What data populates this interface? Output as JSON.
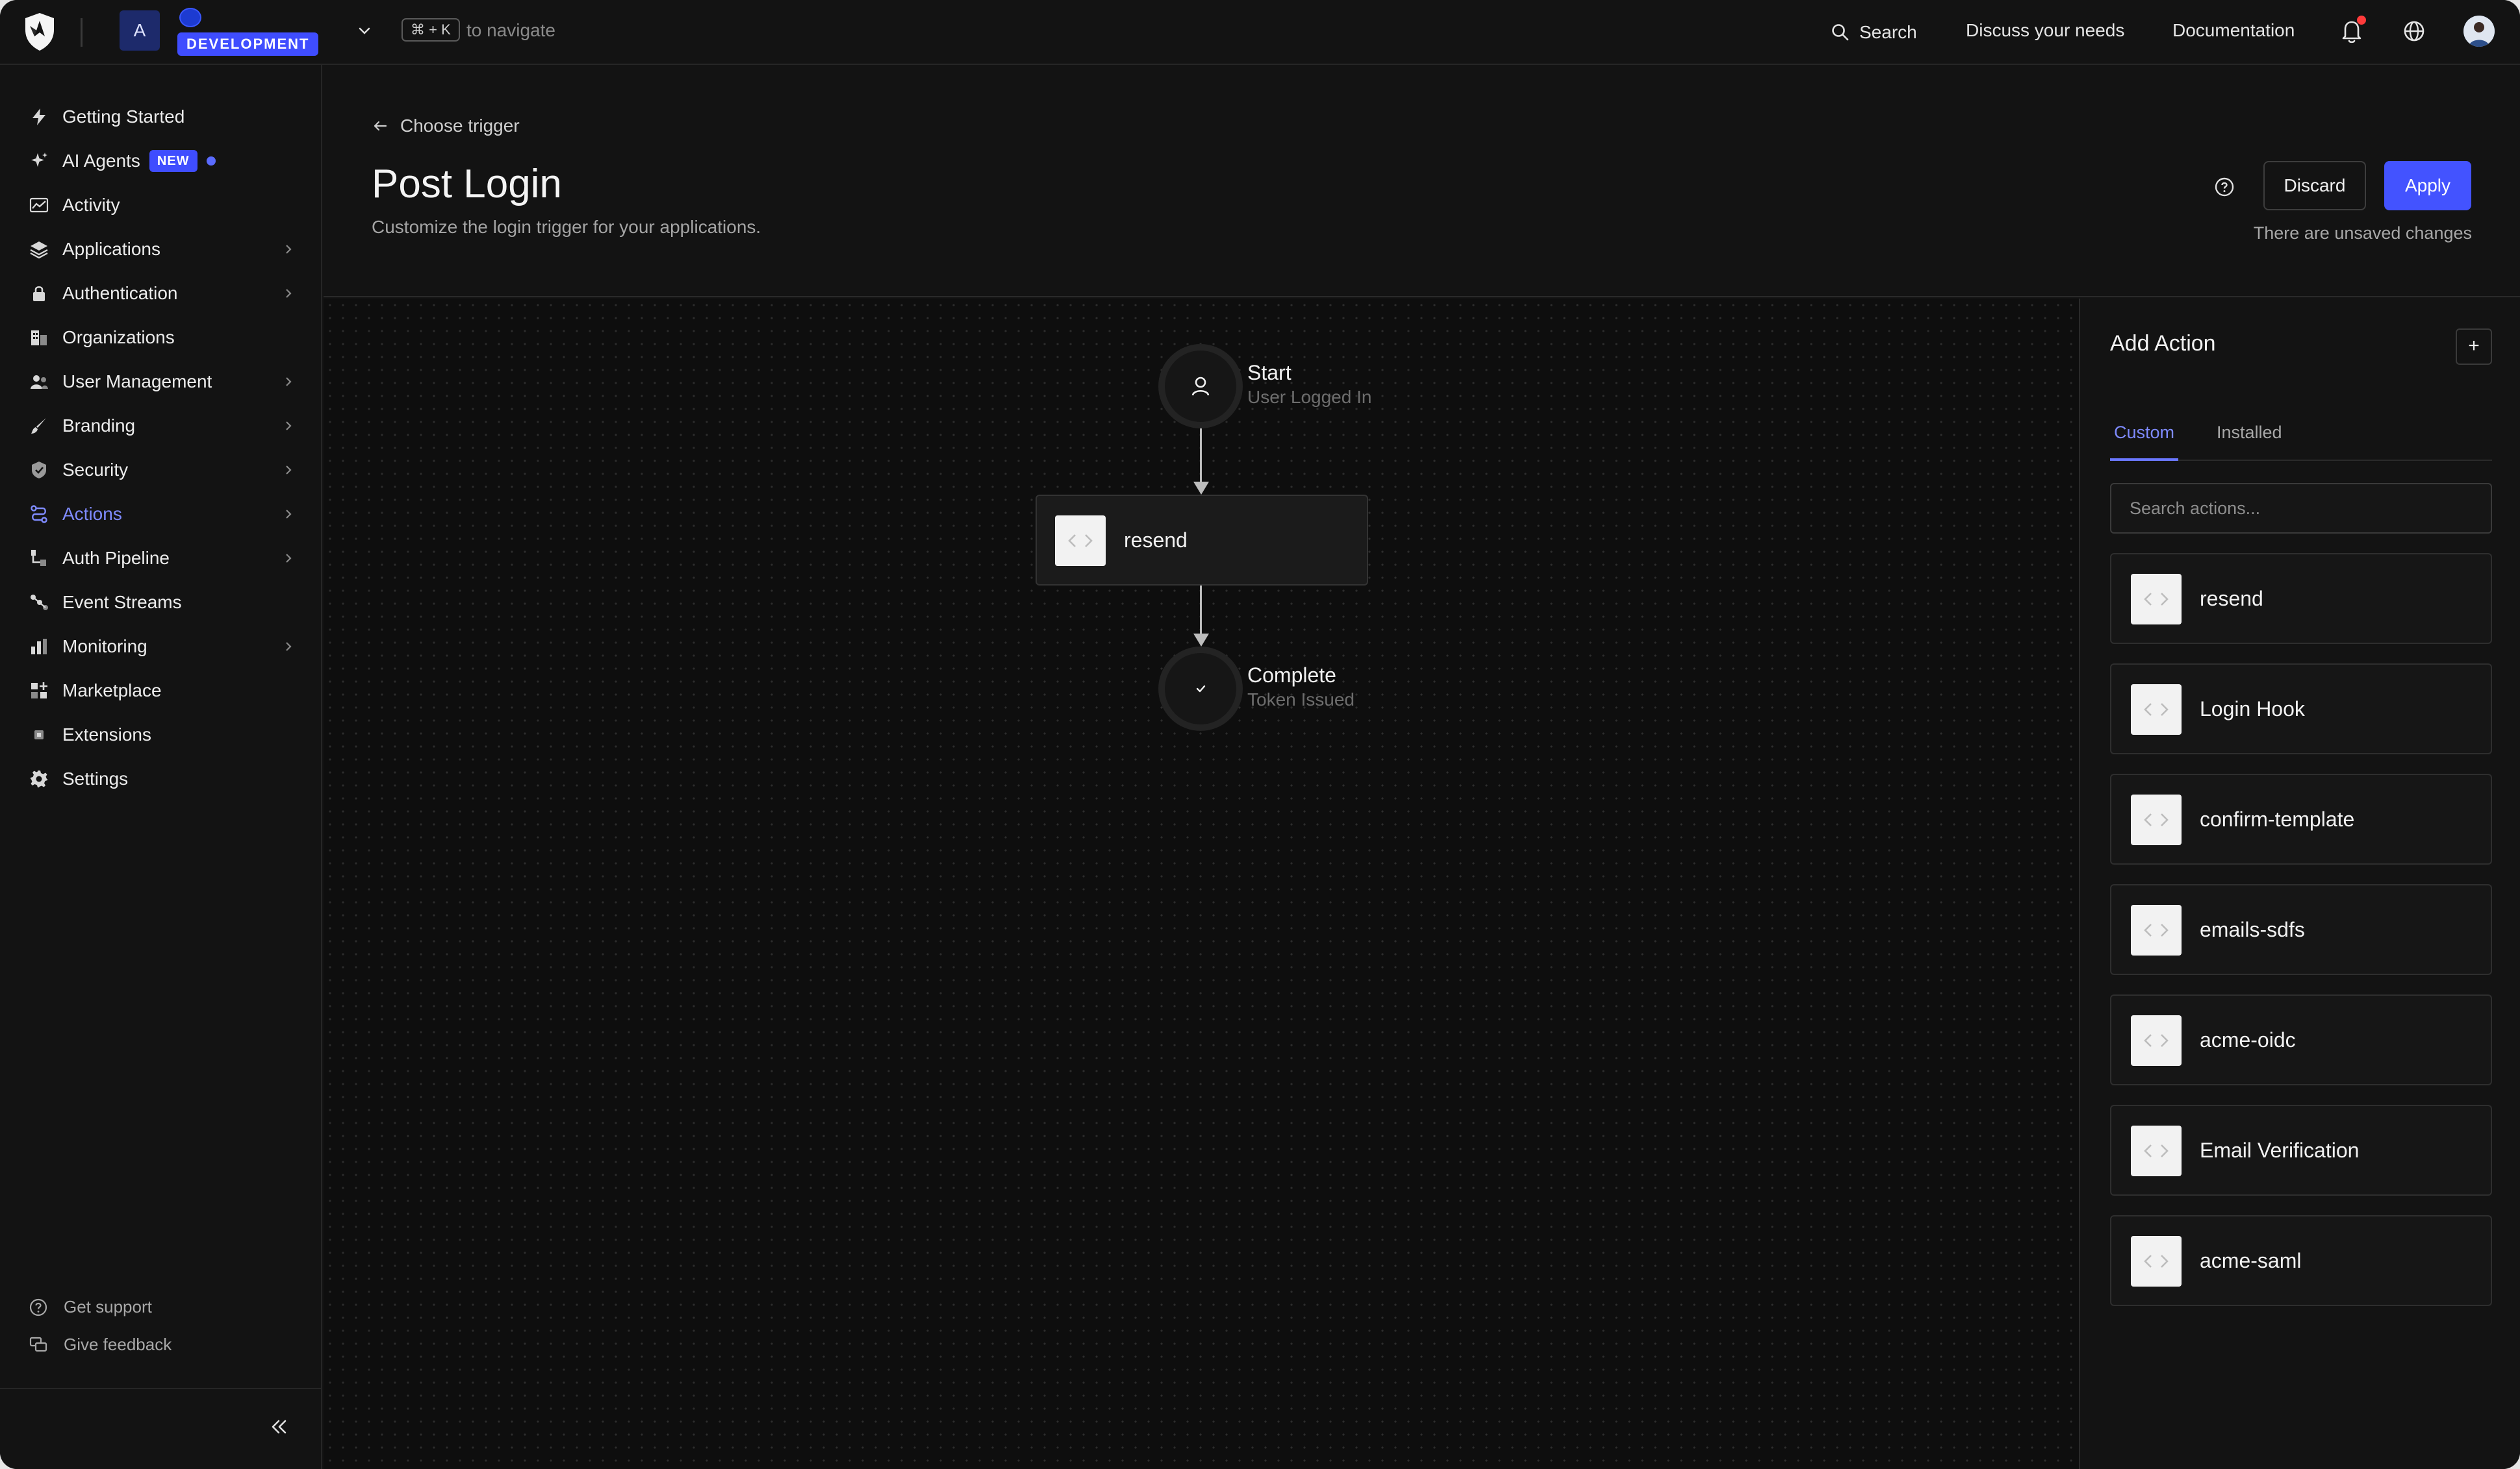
{
  "topbar": {
    "tenant_initial": "A",
    "environment": "DEVELOPMENT",
    "shortcut": "⌘ + K",
    "shortcut_hint": "to navigate",
    "search_label": "Search",
    "discuss_label": "Discuss your needs",
    "docs_label": "Documentation",
    "notification_dot_color": "#ff3b3b"
  },
  "sidebar": {
    "items": [
      {
        "label": "Getting Started",
        "icon": "bolt-icon",
        "has_chevron": false
      },
      {
        "label": "AI Agents",
        "icon": "sparkle-icon",
        "badge": "NEW",
        "has_chevron": false
      },
      {
        "label": "Activity",
        "icon": "activity-chart-icon",
        "has_chevron": false
      },
      {
        "label": "Applications",
        "icon": "layers-icon",
        "has_chevron": true
      },
      {
        "label": "Authentication",
        "icon": "lock-icon",
        "has_chevron": true
      },
      {
        "label": "Organizations",
        "icon": "building-icon",
        "has_chevron": false
      },
      {
        "label": "User Management",
        "icon": "users-icon",
        "has_chevron": true
      },
      {
        "label": "Branding",
        "icon": "brush-icon",
        "has_chevron": true
      },
      {
        "label": "Security",
        "icon": "shield-check-icon",
        "has_chevron": true
      },
      {
        "label": "Actions",
        "icon": "actions-flow-icon",
        "has_chevron": true,
        "active": true
      },
      {
        "label": "Auth Pipeline",
        "icon": "pipeline-icon",
        "has_chevron": true
      },
      {
        "label": "Event Streams",
        "icon": "streams-icon",
        "has_chevron": false
      },
      {
        "label": "Monitoring",
        "icon": "bar-chart-icon",
        "has_chevron": true
      },
      {
        "label": "Marketplace",
        "icon": "grid-plus-icon",
        "has_chevron": false
      },
      {
        "label": "Extensions",
        "icon": "extensions-icon",
        "has_chevron": false
      },
      {
        "label": "Settings",
        "icon": "gear-icon",
        "has_chevron": false
      }
    ],
    "footer": {
      "support_label": "Get support",
      "feedback_label": "Give feedback"
    }
  },
  "header": {
    "back_label": "Choose trigger",
    "title": "Post Login",
    "subtitle": "Customize the login trigger for your applications.",
    "discard_label": "Discard",
    "apply_label": "Apply",
    "unsaved_text": "There are unsaved changes"
  },
  "flow": {
    "start": {
      "label": "Start",
      "sub": "User Logged In"
    },
    "action": {
      "label": "resend"
    },
    "end": {
      "label": "Complete",
      "sub": "Token Issued"
    }
  },
  "panel": {
    "title": "Add Action",
    "add_symbol": "+",
    "tabs": [
      {
        "label": "Custom",
        "active": true
      },
      {
        "label": "Installed",
        "active": false
      }
    ],
    "search_placeholder": "Search actions...",
    "actions": [
      "resend",
      "Login Hook",
      "confirm-template",
      "emails-sdfs",
      "acme-oidc",
      "Email Verification",
      "acme-saml"
    ]
  },
  "colors": {
    "accent": "#4353ff",
    "active_nav": "#7f8bff",
    "background": "#131313",
    "canvas": "#0e0e0e"
  }
}
